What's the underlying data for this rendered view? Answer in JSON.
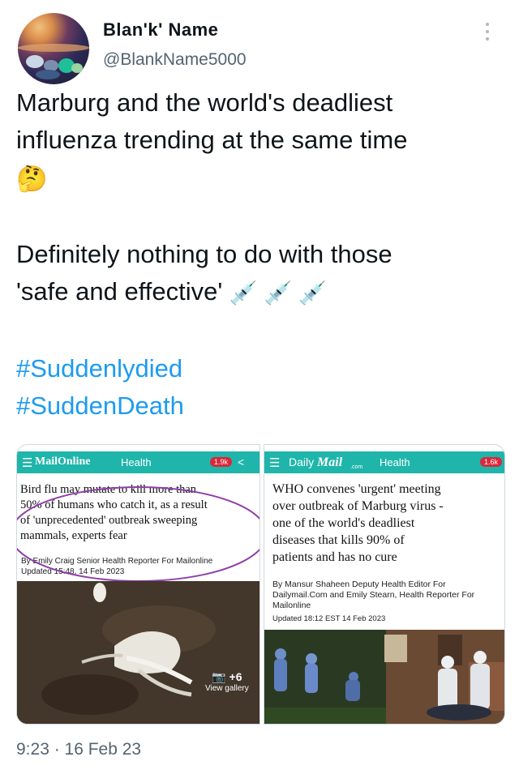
{
  "tweet": {
    "author_name": "Blan'k' Name",
    "author_handle": "@BlankName5000",
    "body": {
      "line1": "Marburg and the world's deadliest",
      "line2": "influenza trending at the same time",
      "line3_emoji": "🤔",
      "line4": "Definitely nothing to do with those",
      "line5": "'safe and effective'",
      "line5_emoji": "💉 💉 💉",
      "hashtag1": "#Suddenlydied",
      "hashtag2": "#SuddenDeath"
    },
    "timestamp": "9:23 · 16 Feb 23"
  },
  "left_card": {
    "brand": "MailOnline",
    "section": "Health",
    "count_badge": "1.9k",
    "headline": [
      "Bird flu may mutate to kill more than",
      "50% of humans who catch it, as a result",
      "of 'unprecedented' outbreak sweeping",
      "mammals, experts fear"
    ],
    "byline": "By Emily Craig Senior Health Reporter For Mailonline",
    "updated": "Updated 15:48, 14 Feb 2023",
    "gallery_count": "+6",
    "gallery_label": "View gallery"
  },
  "right_card": {
    "brand_prefix": "Daily",
    "brand": "Mail",
    "brand_sub": ".com",
    "section": "Health",
    "count_badge": "1.6k",
    "headline": [
      "WHO convenes 'urgent' meeting",
      "over outbreak of Marburg virus -",
      "one of the world's deadliest",
      "diseases that kills 90% of",
      "patients and has no cure"
    ],
    "byline": [
      "By Mansur Shaheen Deputy Health Editor For",
      "Dailymail.Com and Emily Stearn, Health Reporter For",
      "Mailonline"
    ],
    "updated": "Updated 18:12 EST 14 Feb 2023"
  },
  "colors": {
    "link": "#1d9bf0",
    "muted": "#536471",
    "dailymail_teal": "#1fb5aa",
    "highlight_circle": "#8e3fa8"
  },
  "icons": [
    "more-vertical-icon",
    "menu-icon",
    "share-icon",
    "camera-icon"
  ]
}
